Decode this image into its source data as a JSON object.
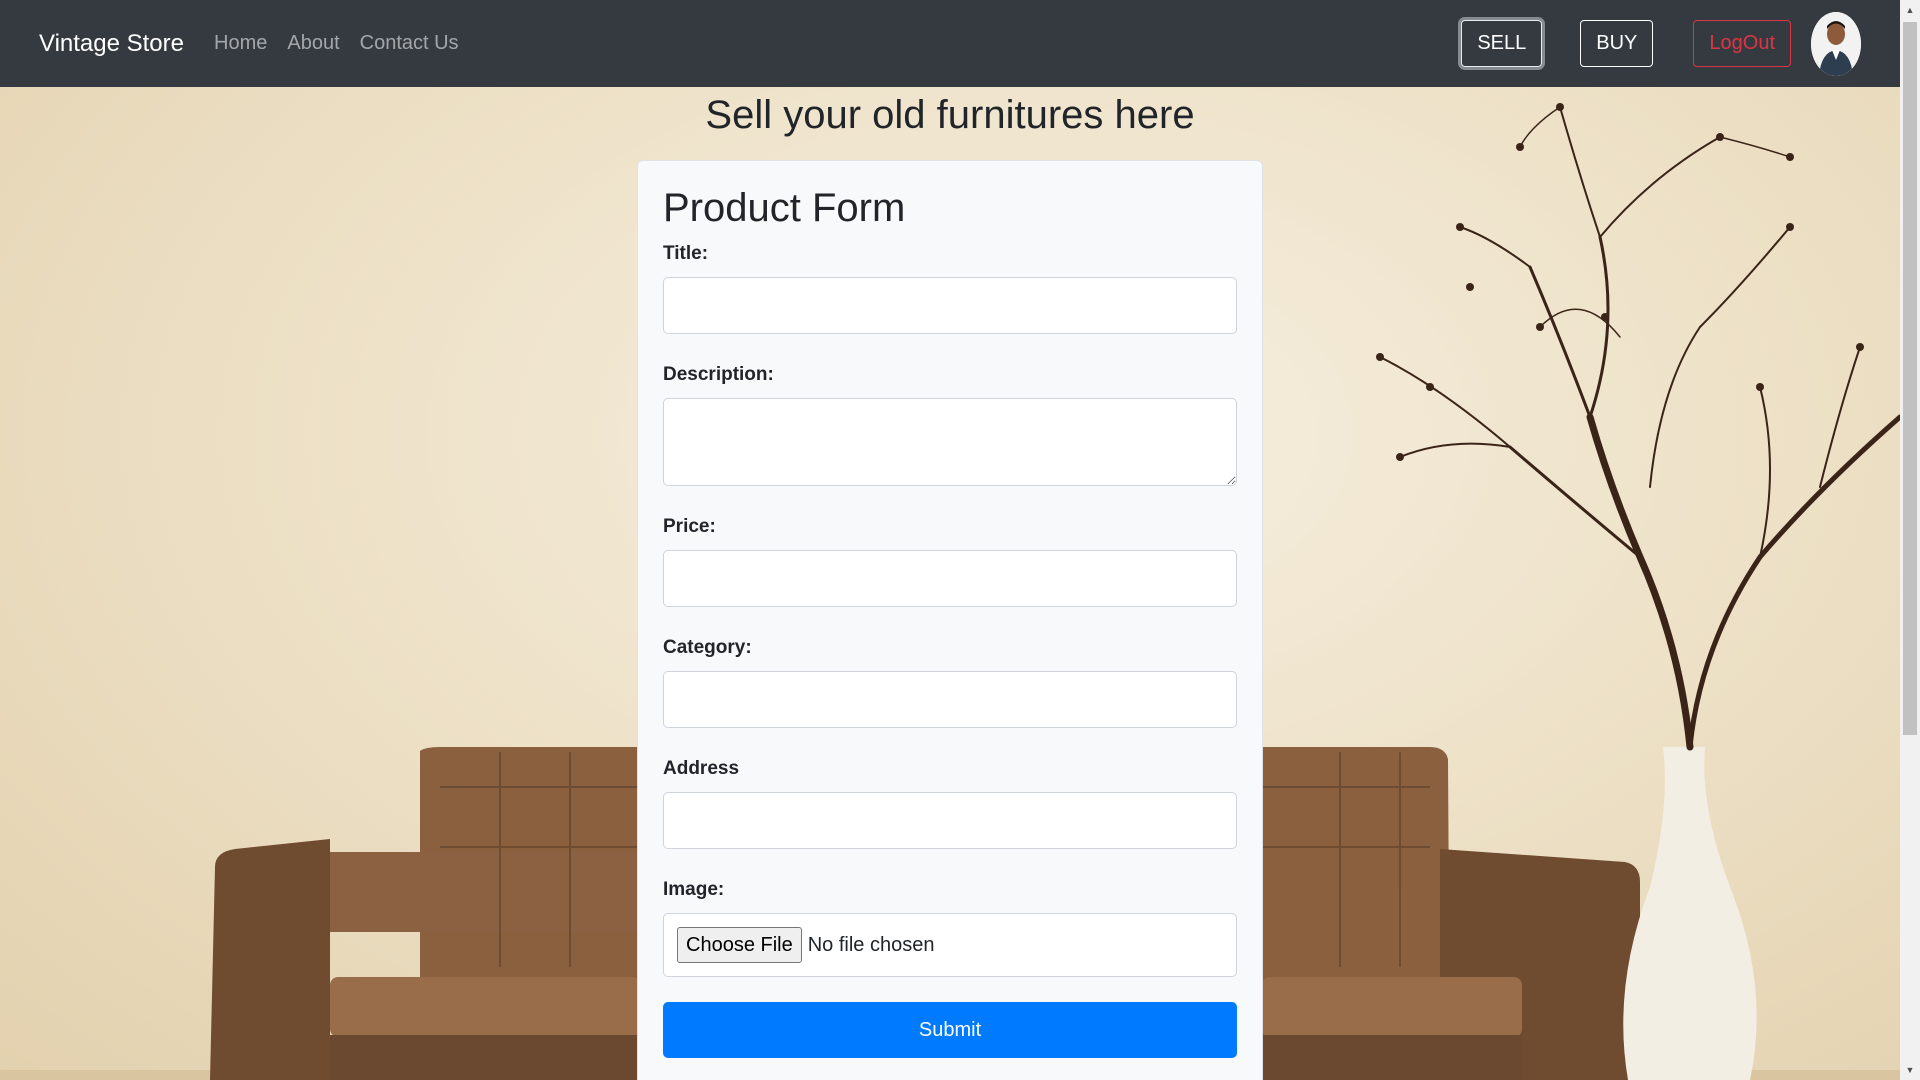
{
  "navbar": {
    "brand": "Vintage Store",
    "links": [
      "Home",
      "About",
      "Contact Us"
    ],
    "sell_label": "SELL",
    "buy_label": "BUY",
    "logout_label": "LogOut"
  },
  "page": {
    "heading": "Sell your old furnitures here"
  },
  "form": {
    "title": "Product Form",
    "fields": {
      "title_label": "Title:",
      "title_value": "",
      "description_label": "Description:",
      "description_value": "",
      "price_label": "Price:",
      "price_value": "",
      "category_label": "Category:",
      "category_value": "",
      "address_label": "Address",
      "address_value": "",
      "image_label": "Image:",
      "file_button": "Choose File",
      "file_status": "No file chosen"
    },
    "submit_label": "Submit"
  },
  "colors": {
    "navbar_bg": "#343a40",
    "primary": "#007bff",
    "danger": "#dc3545"
  },
  "icons": {
    "avatar": "user-avatar-photo",
    "scroll_up": "scroll-up-arrow-icon",
    "scroll_down": "scroll-down-arrow-icon"
  }
}
